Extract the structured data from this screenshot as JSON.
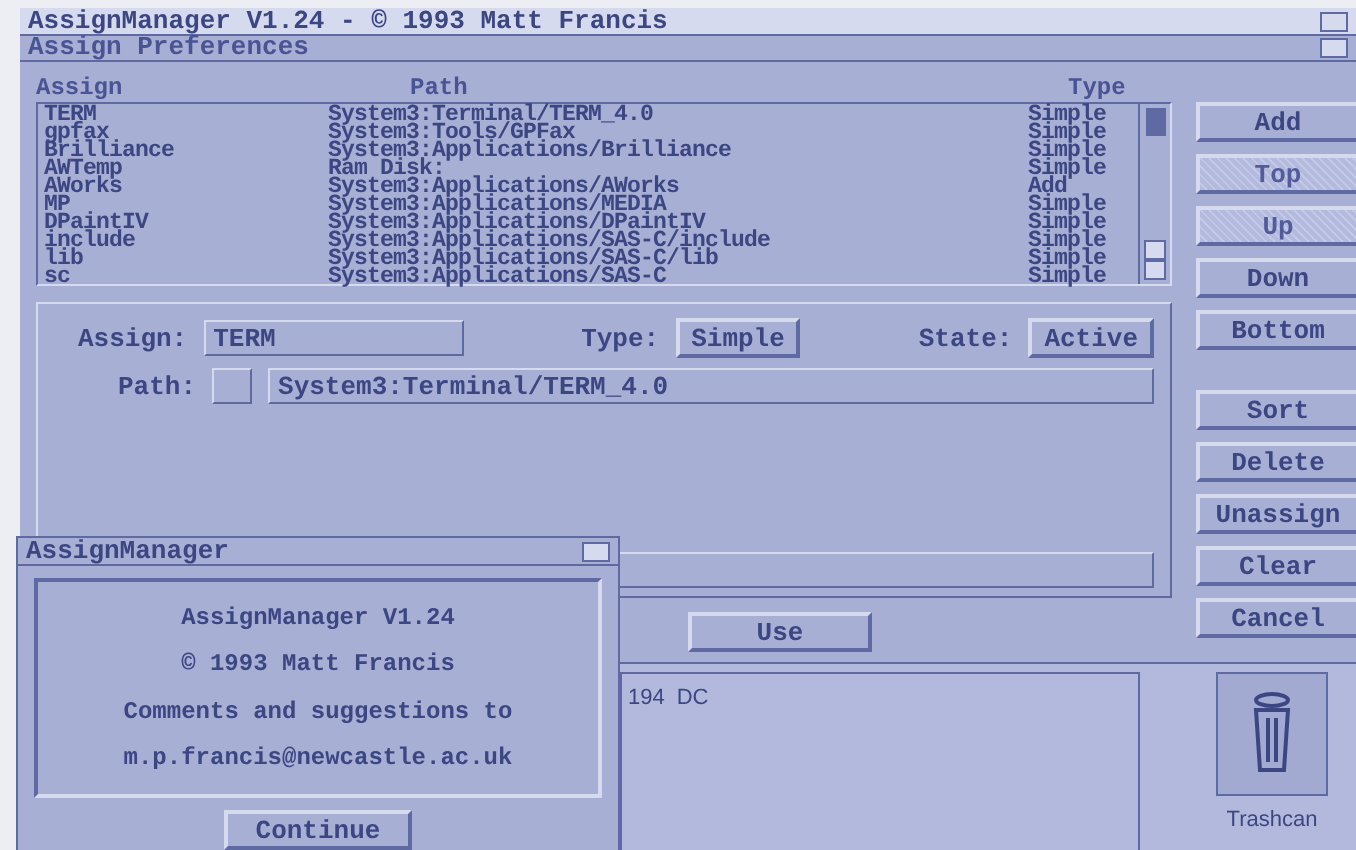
{
  "screen_title": "AssignManager V1.24 - © 1993 Matt Francis",
  "window": {
    "title": "Assign Preferences",
    "columns": [
      "Assign",
      "Path",
      "Type"
    ],
    "rows": [
      {
        "assign": "TERM",
        "path": "System3:Terminal/TERM_4.0",
        "type": "Simple"
      },
      {
        "assign": "gpfax",
        "path": "System3:Tools/GPFax",
        "type": "Simple"
      },
      {
        "assign": "Brilliance",
        "path": "System3:Applications/Brilliance",
        "type": "Simple"
      },
      {
        "assign": "AWTemp",
        "path": "Ram Disk:",
        "type": "Simple"
      },
      {
        "assign": "AWorks",
        "path": "System3:Applications/AWorks",
        "type": "Add"
      },
      {
        "assign": "MP",
        "path": "System3:Applications/MEDIA",
        "type": "Simple"
      },
      {
        "assign": "DPaintIV",
        "path": "System3:Applications/DPaintIV",
        "type": "Simple"
      },
      {
        "assign": "include",
        "path": "System3:Applications/SAS-C/include",
        "type": "Simple"
      },
      {
        "assign": "lib",
        "path": "System3:Applications/SAS-C/lib",
        "type": "Simple"
      },
      {
        "assign": "sc",
        "path": "System3:Applications/SAS-C",
        "type": "Simple"
      }
    ],
    "side_buttons": [
      {
        "label": "Add",
        "disabled": false
      },
      {
        "label": "Top",
        "disabled": true
      },
      {
        "label": "Up",
        "disabled": true
      },
      {
        "label": "Down",
        "disabled": false
      },
      {
        "label": "Bottom",
        "disabled": false
      },
      {
        "label": "Sort",
        "disabled": false
      },
      {
        "label": "Delete",
        "disabled": false
      },
      {
        "label": "Unassign",
        "disabled": false
      },
      {
        "label": "Clear",
        "disabled": false
      },
      {
        "label": "Cancel",
        "disabled": false
      }
    ],
    "form": {
      "assign_label": "Assign:",
      "assign_value": "TERM",
      "type_label": "Type:",
      "type_value": "Simple",
      "state_label": "State:",
      "state_value": "Active",
      "path_label": "Path:",
      "path_value": "System3:Terminal/TERM_4.0"
    },
    "use_button": "Use"
  },
  "workbench": {
    "texts": [
      "194",
      "DC"
    ],
    "trashcan_label": "Trashcan"
  },
  "requester": {
    "title": "AssignManager",
    "lines": [
      "AssignManager V1.24",
      "© 1993 Matt Francis",
      "Comments and suggestions to",
      "m.p.francis@newcastle.ac.uk"
    ],
    "button": "Continue"
  }
}
